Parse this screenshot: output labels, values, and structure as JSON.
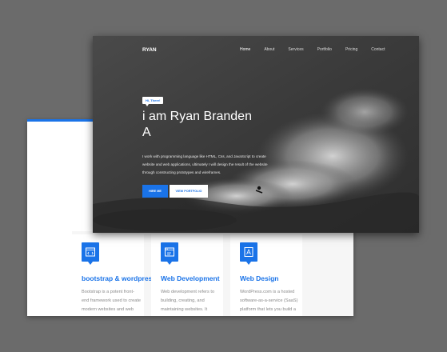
{
  "site": {
    "brand": "RYAN"
  },
  "nav": {
    "items": [
      "Home",
      "About",
      "Services",
      "Portfolio",
      "Pricing",
      "Contact"
    ],
    "active": "Home"
  },
  "hero": {
    "badge": "Hi, There!",
    "headline_line1": "i am Ryan Branden",
    "headline_line2": "A",
    "intro": "I work with programming language like HTML, Css, and JavaScript to create website and web applications, ultimately I will design the result of the website through constructing prototypes and wireframes.",
    "hire_button": "HIRE ME",
    "portfolio_button": "VIEW PORTFOLIO"
  },
  "services": [
    {
      "icon": "code-window-icon",
      "title": "bootstrap & wordpress",
      "desc": "Bootstrap is a potent front-end framework used to create modern websites and web"
    },
    {
      "icon": "browser-code-icon",
      "title": "Web Development",
      "desc": "Web development refers to building, creating, and maintaining websites. It"
    },
    {
      "icon": "web-design-icon",
      "title": "Web Design",
      "desc": "WordPress.com is a hosted software-as-a-service (SaaS) platform that lets you build a"
    }
  ],
  "colors": {
    "accent": "#1a73e8",
    "frame": "#6b6b6b",
    "hero_bg": "#3a3a3a"
  }
}
